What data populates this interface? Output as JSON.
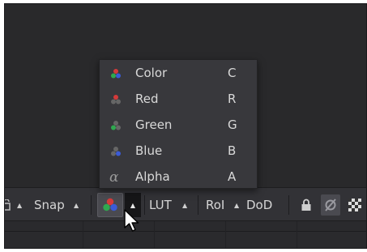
{
  "toolbar": {
    "snap_label": "Snap",
    "lut_label": "LUT",
    "roi_label": "RoI",
    "dod_label": "DoD"
  },
  "channel_menu": {
    "items": [
      {
        "label": "Color",
        "shortcut": "C",
        "icon": "rgb-color-icon"
      },
      {
        "label": "Red",
        "shortcut": "R",
        "icon": "red-channel-icon"
      },
      {
        "label": "Green",
        "shortcut": "G",
        "icon": "green-channel-icon"
      },
      {
        "label": "Blue",
        "shortcut": "B",
        "icon": "blue-channel-icon"
      },
      {
        "label": "Alpha",
        "shortcut": "A",
        "icon": "alpha-channel-icon",
        "glyph": "α"
      }
    ]
  },
  "colors": {
    "red": "#d43a3a",
    "green": "#2fa84f",
    "blue": "#3b5bd6",
    "dim": "#666666"
  }
}
